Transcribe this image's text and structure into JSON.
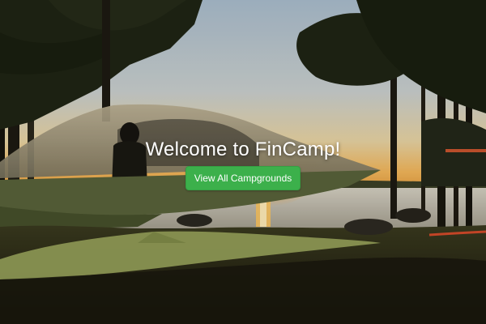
{
  "hero": {
    "title": "Welcome to FinCamp!",
    "cta_label": "View All Campgrounds",
    "background_image": "tree-tent-over-lake-at-sunset"
  },
  "colors": {
    "button_green": "#3cb04b",
    "title_text": "#ffffff",
    "sky_top": "#9fb4c8",
    "sun_glow": "#f7b347",
    "lake": "#c9c4b8"
  }
}
